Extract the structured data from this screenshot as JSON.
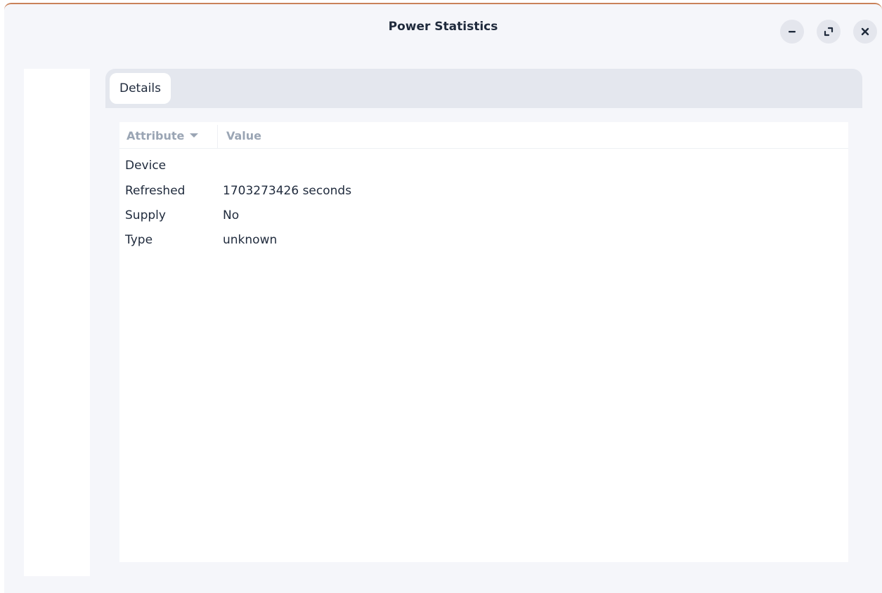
{
  "window": {
    "title": "Power Statistics",
    "controls": {
      "minimize_icon": "minimize-icon",
      "maximize_icon": "maximize-icon",
      "close_icon": "close-icon"
    }
  },
  "tabs": [
    {
      "label": "Details",
      "selected": true
    }
  ],
  "details_table": {
    "columns": {
      "attribute": "Attribute",
      "value": "Value"
    },
    "sort_icon": "chevron-down-icon",
    "rows": [
      {
        "attribute": "Device",
        "value": ""
      },
      {
        "attribute": "Refreshed",
        "value": "1703273426 seconds"
      },
      {
        "attribute": "Supply",
        "value": "No"
      },
      {
        "attribute": "Type",
        "value": "unknown"
      }
    ]
  },
  "colors": {
    "window_bg": "#f5f6fa",
    "accent_border": "#c9825a",
    "tabbar_bg": "#e4e7ee",
    "text": "#1f2a3c",
    "header_text": "#9aa5b4"
  }
}
